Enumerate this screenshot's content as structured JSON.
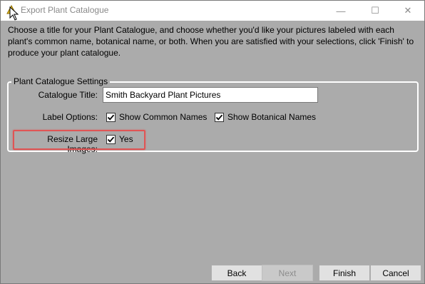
{
  "window": {
    "title": "Export Plant Catalogue",
    "controls": {
      "minimize": "—",
      "maximize": "☐",
      "close": "✕"
    }
  },
  "instructions": "Choose a title for your Plant Catalogue, and choose whether you'd like your pictures labeled with each plant's common name, botanical name, or both. When you are satisfied with your selections, click 'Finish' to produce your plant catalogue.",
  "settings": {
    "group_title": "Plant Catalogue Settings",
    "catalogue_title_label": "Catalogue Title:",
    "catalogue_title_value": "Smith Backyard Plant Pictures",
    "label_options_label": "Label Options:",
    "show_common_names": {
      "label": "Show Common Names",
      "checked": true
    },
    "show_botanical_names": {
      "label": "Show Botanical Names",
      "checked": true
    },
    "resize_label": "Resize Large Images:",
    "resize_yes": {
      "label": "Yes",
      "checked": true
    }
  },
  "buttons": {
    "back": "Back",
    "next": "Next",
    "finish": "Finish",
    "cancel": "Cancel"
  },
  "colors": {
    "background": "#ababab",
    "highlight": "#e05555"
  },
  "icons": {
    "app": "app-triangle-icon",
    "cursor": "mouse-cursor-icon",
    "check": "checkmark-icon"
  }
}
